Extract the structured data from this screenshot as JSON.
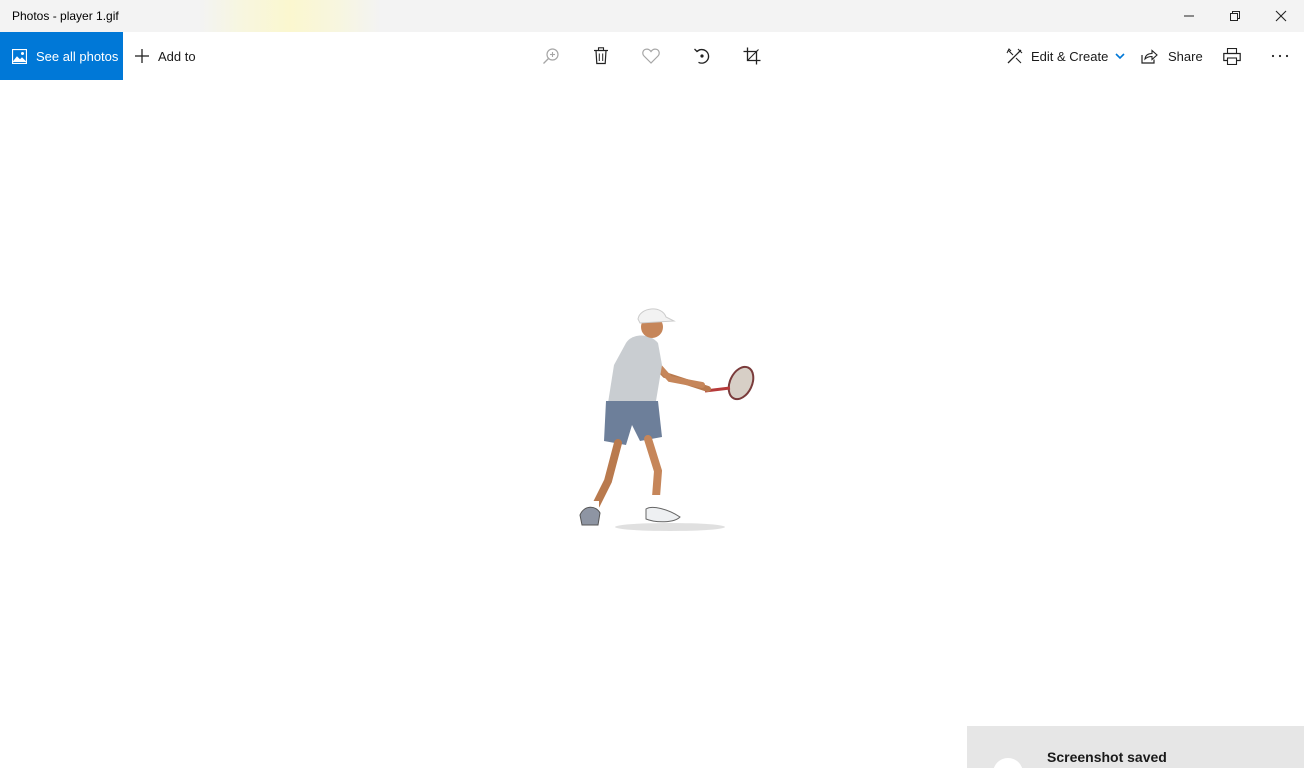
{
  "window": {
    "title": "Photos - player 1.gif",
    "buttons": [
      "minimize-icon",
      "restore-icon",
      "close-icon"
    ]
  },
  "toolbar": {
    "see_all_label": "See all photos",
    "add_to_label": "Add to",
    "center_icons": [
      "zoom-in-icon",
      "delete-icon",
      "heart-icon",
      "rotate-icon",
      "crop-icon"
    ],
    "edit_create_label": "Edit & Create",
    "share_label": "Share",
    "right_icons": [
      "print-icon",
      "more-icon"
    ]
  },
  "colors": {
    "accent": "#0078d7",
    "titlebar": "#f3f3f3",
    "toast_bg": "#e6e6e6"
  },
  "photo": {
    "subject": "tennis-player-image"
  },
  "toast": {
    "title": "Screenshot saved"
  }
}
